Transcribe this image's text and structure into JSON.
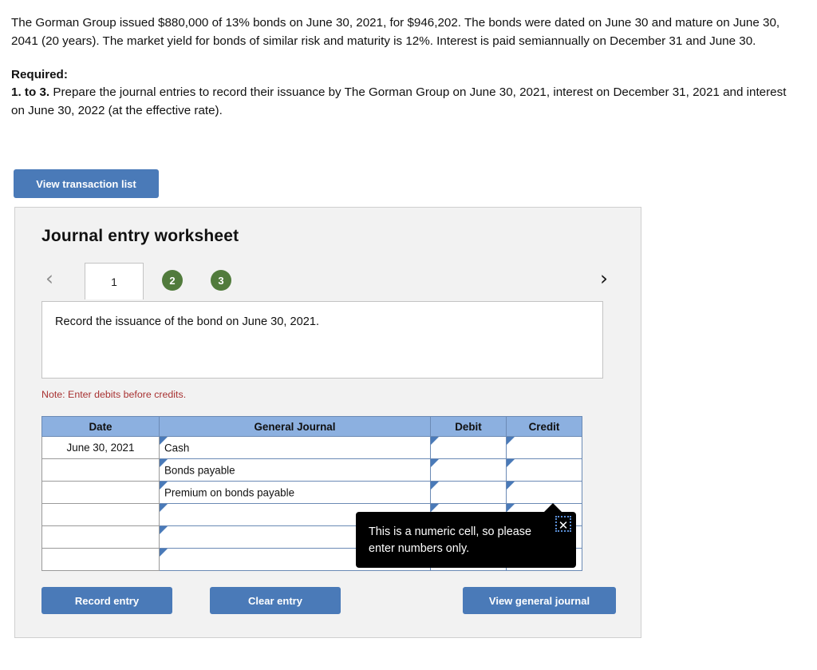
{
  "problem": {
    "paragraph1": "The Gorman Group issued $880,000 of 13% bonds on June 30, 2021, for $946,202. The bonds were dated on June 30 and mature on June 30, 2041 (20 years). The market yield for bonds of similar risk and maturity is 12%. Interest is paid semiannually on December 31 and June 30.",
    "required_label": "Required:",
    "required_number": "1. to 3.",
    "required_text": " Prepare the journal entries to record their issuance by The Gorman Group on June 30, 2021, interest on December 31, 2021 and interest on June 30, 2022 (at the effective rate)."
  },
  "toolbar": {
    "view_transaction_list": "View transaction list"
  },
  "panel": {
    "title": "Journal entry worksheet",
    "tabs": {
      "prev_icon": "‹",
      "next_icon": "›",
      "active": "1",
      "others": [
        "2",
        "3"
      ]
    },
    "instruction": "Record the issuance of the bond on June 30, 2021.",
    "note": "Note: Enter debits before credits."
  },
  "table": {
    "headers": [
      "Date",
      "General Journal",
      "Debit",
      "Credit"
    ],
    "rows": [
      {
        "date": "June 30, 2021",
        "account": "Cash",
        "debit": "",
        "credit": ""
      },
      {
        "date": "",
        "account": "Bonds payable",
        "debit": "",
        "credit": ""
      },
      {
        "date": "",
        "account": "Premium on bonds payable",
        "debit": "",
        "credit": ""
      },
      {
        "date": "",
        "account": "",
        "debit": "",
        "credit": ""
      },
      {
        "date": "",
        "account": "",
        "debit": "",
        "credit": ""
      },
      {
        "date": "",
        "account": "",
        "debit": "",
        "credit": ""
      }
    ]
  },
  "tooltip": {
    "message": "This is a numeric cell, so please enter numbers only.",
    "close_label": "✕"
  },
  "actions": {
    "record_entry": "Record entry",
    "clear_entry": "Clear entry",
    "view_general_journal": "View general journal"
  },
  "colors": {
    "button_blue": "#4a7ab8",
    "header_blue": "#8cb0e0",
    "tab_green": "#517b3c",
    "note_red": "#a83232",
    "panel_bg": "#f2f2f2",
    "tooltip_bg": "#000000"
  }
}
